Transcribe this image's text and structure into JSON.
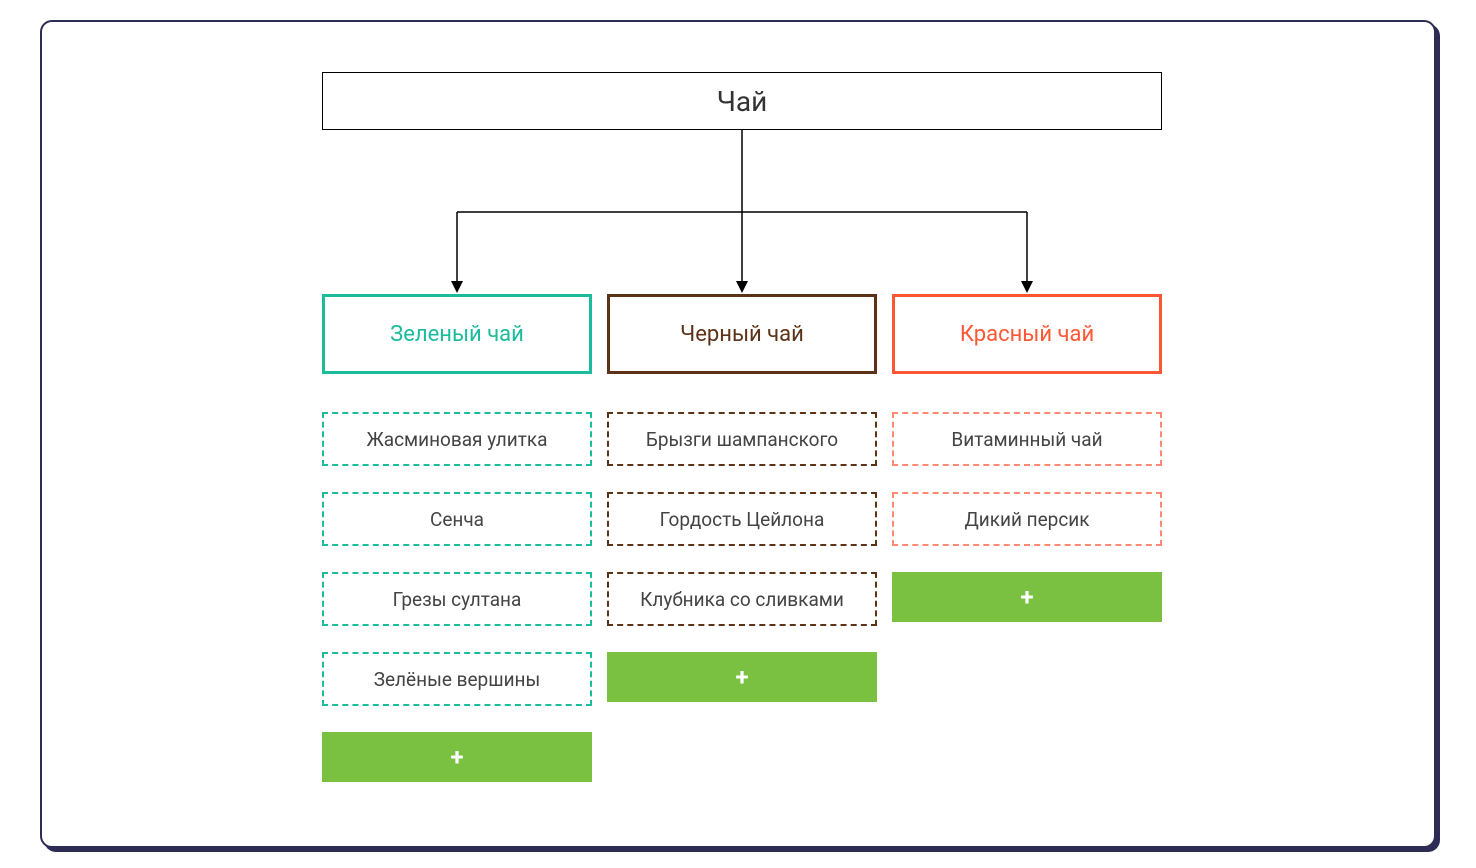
{
  "root": {
    "label": "Чай"
  },
  "colors": {
    "green": "#1abc9c",
    "black": "#5d3317",
    "red": "#ff5733",
    "add_button": "#7ac142",
    "frame": "#2c2c54"
  },
  "categories": {
    "green": {
      "label": "Зеленый чай",
      "items": [
        "Жасминовая улитка",
        "Сенча",
        "Грезы султана",
        "Зелёные вершины"
      ]
    },
    "black": {
      "label": "Черный чай",
      "items": [
        "Брызги шампанского",
        "Гордость Цейлона",
        "Клубника со сливками"
      ]
    },
    "red": {
      "label": "Красный чай",
      "items": [
        "Витаминный чай",
        "Дикий персик"
      ]
    }
  },
  "add_button_label": "+"
}
